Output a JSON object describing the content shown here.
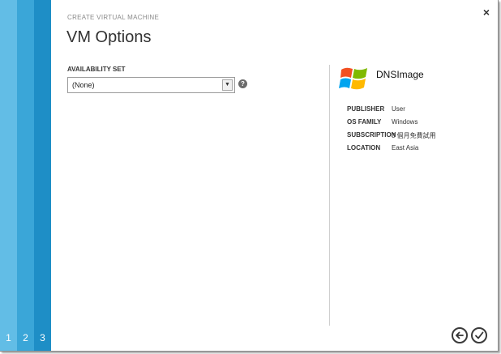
{
  "wizard": {
    "header_label": "CREATE VIRTUAL MACHINE",
    "title": "VM Options",
    "close_glyph": "×",
    "steps": [
      "1",
      "2",
      "3"
    ]
  },
  "form": {
    "availability_set_label": "AVAILABILITY SET",
    "availability_set_value": "(None)",
    "help_glyph": "?"
  },
  "image_info": {
    "name": "DNSImage",
    "logo_icon": "windows-flag-icon",
    "rows": [
      {
        "key": "PUBLISHER",
        "value": "User"
      },
      {
        "key": "OS FAMILY",
        "value": "Windows"
      },
      {
        "key": "SUBSCRIPTION",
        "value": "3 個月免費試用"
      },
      {
        "key": "LOCATION",
        "value": "East Asia"
      }
    ]
  },
  "colors": {
    "stripe_1": "#62bde6",
    "stripe_2": "#3aa6d8",
    "stripe_3": "#1e8ec6"
  }
}
